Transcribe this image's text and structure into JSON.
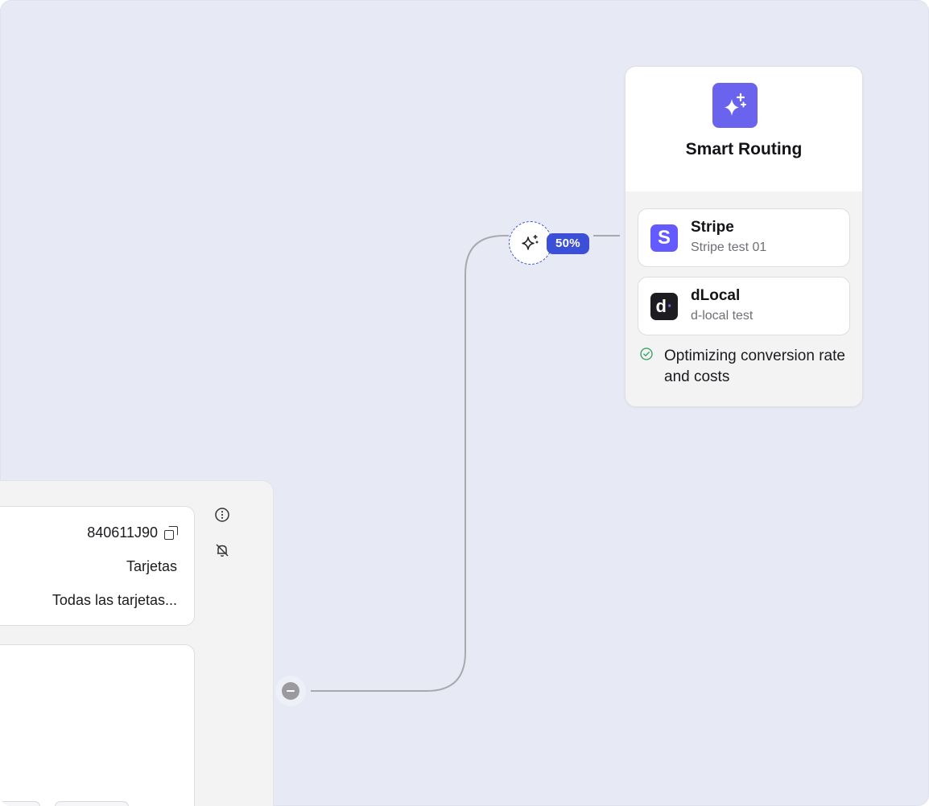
{
  "rule": {
    "id": "840611J90",
    "method": "Tarjetas",
    "cards": "Todas las tarjetas..."
  },
  "split": {
    "percent": "50%"
  },
  "smart_routing": {
    "title": "Smart Routing",
    "providers": [
      {
        "name": "Stripe",
        "label": "Stripe test 01",
        "logo_letter": "S",
        "color": "#635bff"
      },
      {
        "name": "dLocal",
        "label": "d-local test",
        "logo_letter": "d",
        "color": "#1d1d21"
      }
    ],
    "status": "Optimizing conversion rate and costs"
  },
  "colors": {
    "canvas": "#e7eaf5",
    "accent": "#3b50d6",
    "smart_routing_logo": "#6a63ee",
    "success": "#2e9f5a"
  },
  "icons": [
    "copy-icon",
    "more-vertical-icon",
    "bell-off-icon",
    "collapse-icon",
    "sparkles-icon",
    "check-circle-icon"
  ]
}
